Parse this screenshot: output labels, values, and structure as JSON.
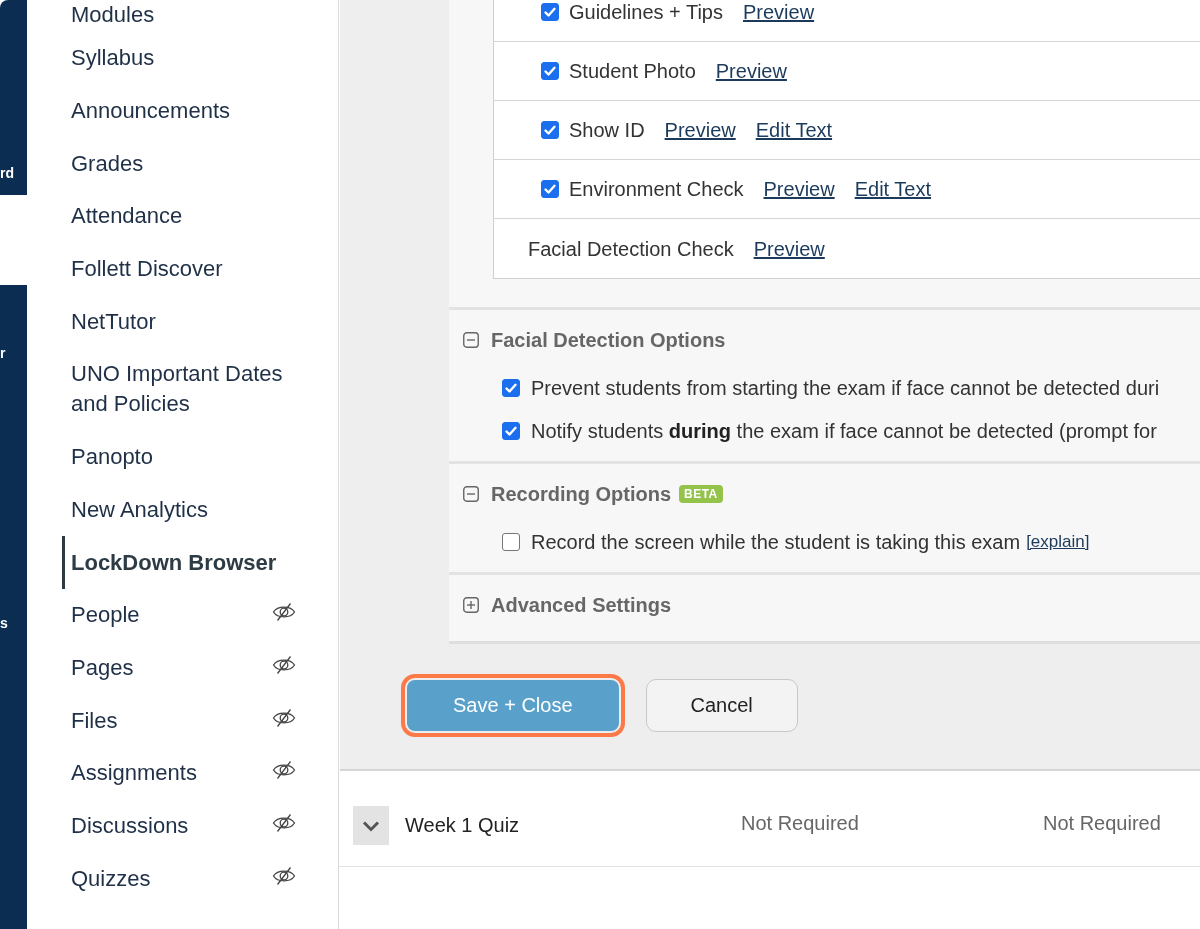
{
  "global_nav": {
    "items": [
      {
        "label": "rd",
        "selected": false
      },
      {
        "selected": true
      },
      {
        "label": "r",
        "selected": false
      },
      {
        "label": "s",
        "selected": false
      }
    ]
  },
  "course_nav": {
    "items": [
      {
        "label": "Modules",
        "selected": false,
        "hidden": false
      },
      {
        "label": "Syllabus",
        "selected": false,
        "hidden": false
      },
      {
        "label": "Announcements",
        "selected": false,
        "hidden": false
      },
      {
        "label": "Grades",
        "selected": false,
        "hidden": false
      },
      {
        "label": "Attendance",
        "selected": false,
        "hidden": false
      },
      {
        "label": "Follett Discover",
        "selected": false,
        "hidden": false
      },
      {
        "label": "NetTutor",
        "selected": false,
        "hidden": false
      },
      {
        "label": "UNO Important Dates and Policies",
        "selected": false,
        "hidden": false
      },
      {
        "label": "Panopto",
        "selected": false,
        "hidden": false
      },
      {
        "label": "New Analytics",
        "selected": false,
        "hidden": false
      },
      {
        "label": "LockDown Browser",
        "selected": true,
        "hidden": false
      },
      {
        "label": "People",
        "selected": false,
        "hidden": true
      },
      {
        "label": "Pages",
        "selected": false,
        "hidden": true
      },
      {
        "label": "Files",
        "selected": false,
        "hidden": true
      },
      {
        "label": "Assignments",
        "selected": false,
        "hidden": true
      },
      {
        "label": "Discussions",
        "selected": false,
        "hidden": true
      },
      {
        "label": "Quizzes",
        "selected": false,
        "hidden": true
      }
    ]
  },
  "lockdown_settings": {
    "startup_sequence": [
      {
        "kind": "checkbox",
        "label": "Guidelines + Tips",
        "checked": true,
        "links": [
          "Preview"
        ]
      },
      {
        "kind": "checkbox",
        "label": "Student Photo",
        "checked": true,
        "links": [
          "Preview"
        ]
      },
      {
        "kind": "checkbox",
        "label": "Show ID",
        "checked": true,
        "links": [
          "Preview",
          "Edit Text"
        ]
      },
      {
        "kind": "checkbox",
        "label": "Environment Check",
        "checked": true,
        "links": [
          "Preview",
          "Edit Text"
        ]
      },
      {
        "kind": "plain",
        "label": "Facial Detection Check",
        "links": [
          "Preview"
        ]
      }
    ],
    "sections": [
      {
        "title": "Facial Detection Options",
        "expanded": true,
        "options": [
          {
            "text": "Prevent students from starting the exam if face cannot be detected duri",
            "checked": true
          },
          {
            "text": "Notify students **during** the exam if face cannot be detected (prompt for",
            "checked": true
          }
        ]
      },
      {
        "title": "Recording Options",
        "badge": "BETA",
        "expanded": true,
        "options": [
          {
            "text": "Record the screen while the student is taking this exam",
            "checked": false,
            "link": "[explain]"
          }
        ]
      },
      {
        "title": "Advanced Settings",
        "expanded": false
      }
    ],
    "buttons": [
      {
        "label": "Save + Close",
        "kind": "primary",
        "highlighted": true
      },
      {
        "label": "Cancel",
        "kind": "secondary",
        "highlighted": false
      }
    ]
  },
  "quiz_table": {
    "rows": [
      {
        "name": "Week 1 Quiz",
        "cells": [
          "Not Required",
          "Not Required"
        ]
      }
    ]
  }
}
